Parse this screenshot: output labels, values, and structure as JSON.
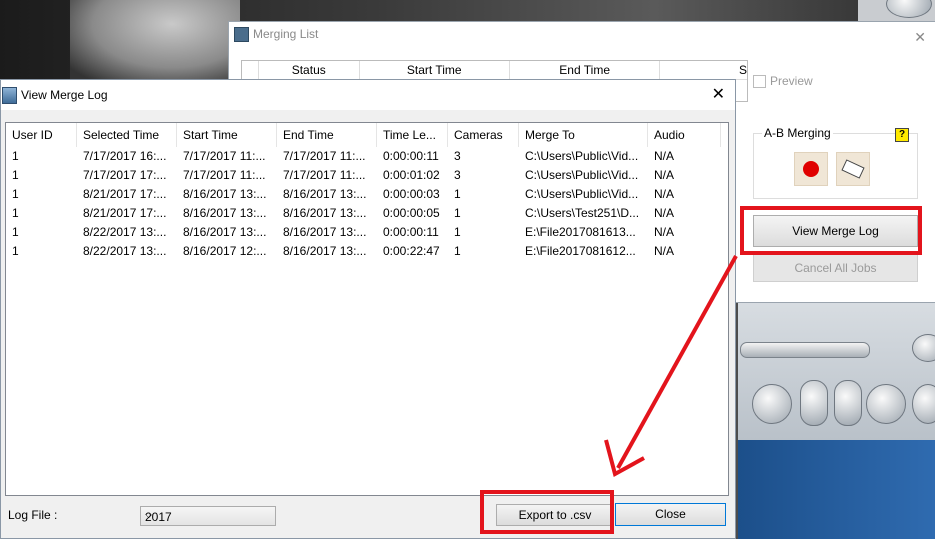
{
  "merging_list": {
    "title": "Merging List",
    "columns": [
      "Status",
      "Start Time",
      "End Time",
      "S"
    ],
    "preview_label": "Preview",
    "ab_merging_label": "A-B Merging",
    "help_label": "?",
    "view_merge_log_label": "View Merge Log",
    "cancel_all_jobs_label": "Cancel All Jobs"
  },
  "merge_log": {
    "title": "View Merge Log",
    "columns": [
      "User ID",
      "Selected Time",
      "Start Time",
      "End Time",
      "Time Le...",
      "Cameras",
      "Merge To",
      "Audio"
    ],
    "rows": [
      [
        "1",
        "7/17/2017 16:...",
        "7/17/2017 11:...",
        "7/17/2017 11:...",
        "0:00:00:11",
        "3",
        "C:\\Users\\Public\\Vid...",
        "N/A"
      ],
      [
        "1",
        "7/17/2017 17:...",
        "7/17/2017 11:...",
        "7/17/2017 11:...",
        "0:00:01:02",
        "3",
        "C:\\Users\\Public\\Vid...",
        "N/A"
      ],
      [
        "1",
        "8/21/2017 17:...",
        "8/16/2017 13:...",
        "8/16/2017 13:...",
        "0:00:00:03",
        "1",
        "C:\\Users\\Public\\Vid...",
        "N/A"
      ],
      [
        "1",
        "8/21/2017 17:...",
        "8/16/2017 13:...",
        "8/16/2017 13:...",
        "0:00:00:05",
        "1",
        "C:\\Users\\Test251\\D...",
        "N/A"
      ],
      [
        "1",
        "8/22/2017 13:...",
        "8/16/2017 13:...",
        "8/16/2017 13:...",
        "0:00:00:11",
        "1",
        "E:\\File2017081613...",
        "N/A"
      ],
      [
        "1",
        "8/22/2017 13:...",
        "8/16/2017 12:...",
        "8/16/2017 13:...",
        "0:00:22:47",
        "1",
        "E:\\File2017081612...",
        "N/A"
      ]
    ],
    "log_file_label": "Log File :",
    "log_file_value": "2017",
    "export_label": "Export to .csv",
    "close_label": "Close"
  },
  "colors": {
    "highlight": "#e3141c",
    "record": "#e00000"
  }
}
